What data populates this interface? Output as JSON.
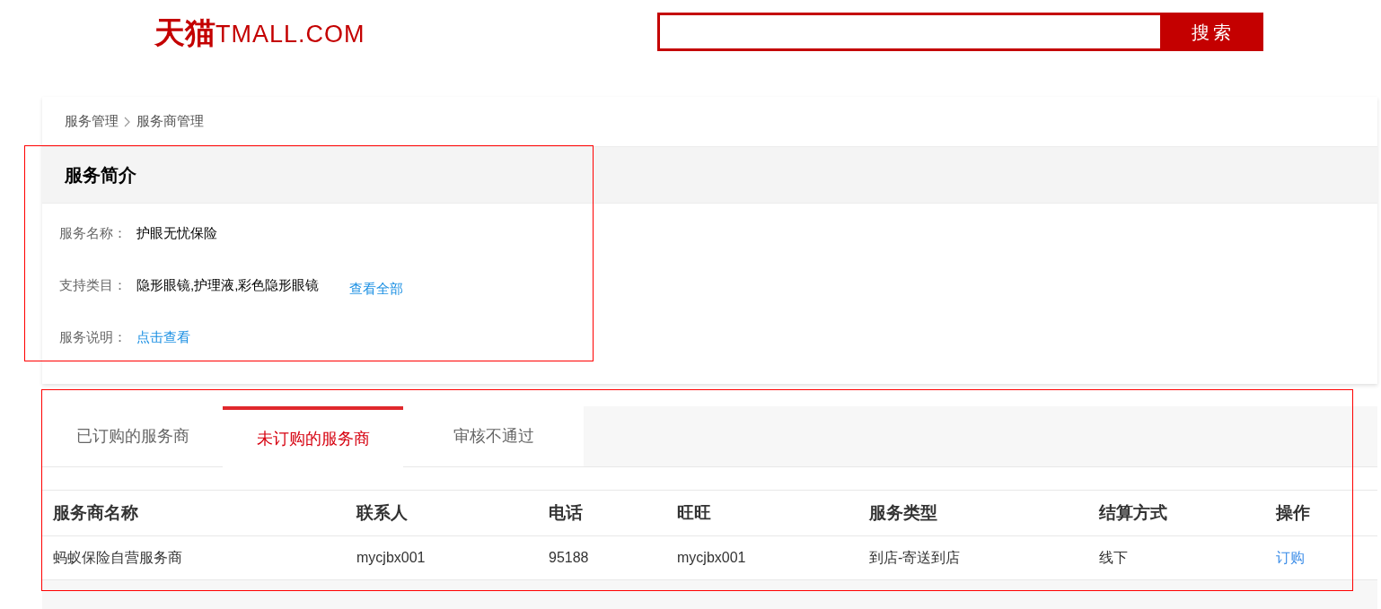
{
  "logo": {
    "chinese": "天猫",
    "latin": "TMALL.COM"
  },
  "search": {
    "button": "搜索"
  },
  "breadcrumb": [
    "服务管理",
    "服务商管理"
  ],
  "service_intro": {
    "title": "服务简介",
    "fields": [
      {
        "label": "服务名称：",
        "value": "护眼无忧保险",
        "kind": "text"
      },
      {
        "label": "支持类目：",
        "value": "隐形眼镜,护理液,彩色隐形眼镜",
        "link": "查看全部",
        "kind": "text_link"
      },
      {
        "label": "服务说明：",
        "link": "点击查看",
        "kind": "link"
      }
    ]
  },
  "tabs": [
    {
      "label": "已订购的服务商",
      "selected": false
    },
    {
      "label": "未订购的服务商",
      "selected": true
    },
    {
      "label": "审核不通过",
      "selected": false
    }
  ],
  "table": {
    "columns": [
      "服务商名称",
      "联系人",
      "电话",
      "旺旺",
      "服务类型",
      "结算方式",
      "操作"
    ],
    "rows": [
      {
        "cells": [
          "蚂蚁保险自营服务商",
          "mycjbx001",
          "95188",
          "mycjbx001",
          "到店-寄送到店",
          "线下"
        ],
        "action": "订购"
      }
    ]
  }
}
